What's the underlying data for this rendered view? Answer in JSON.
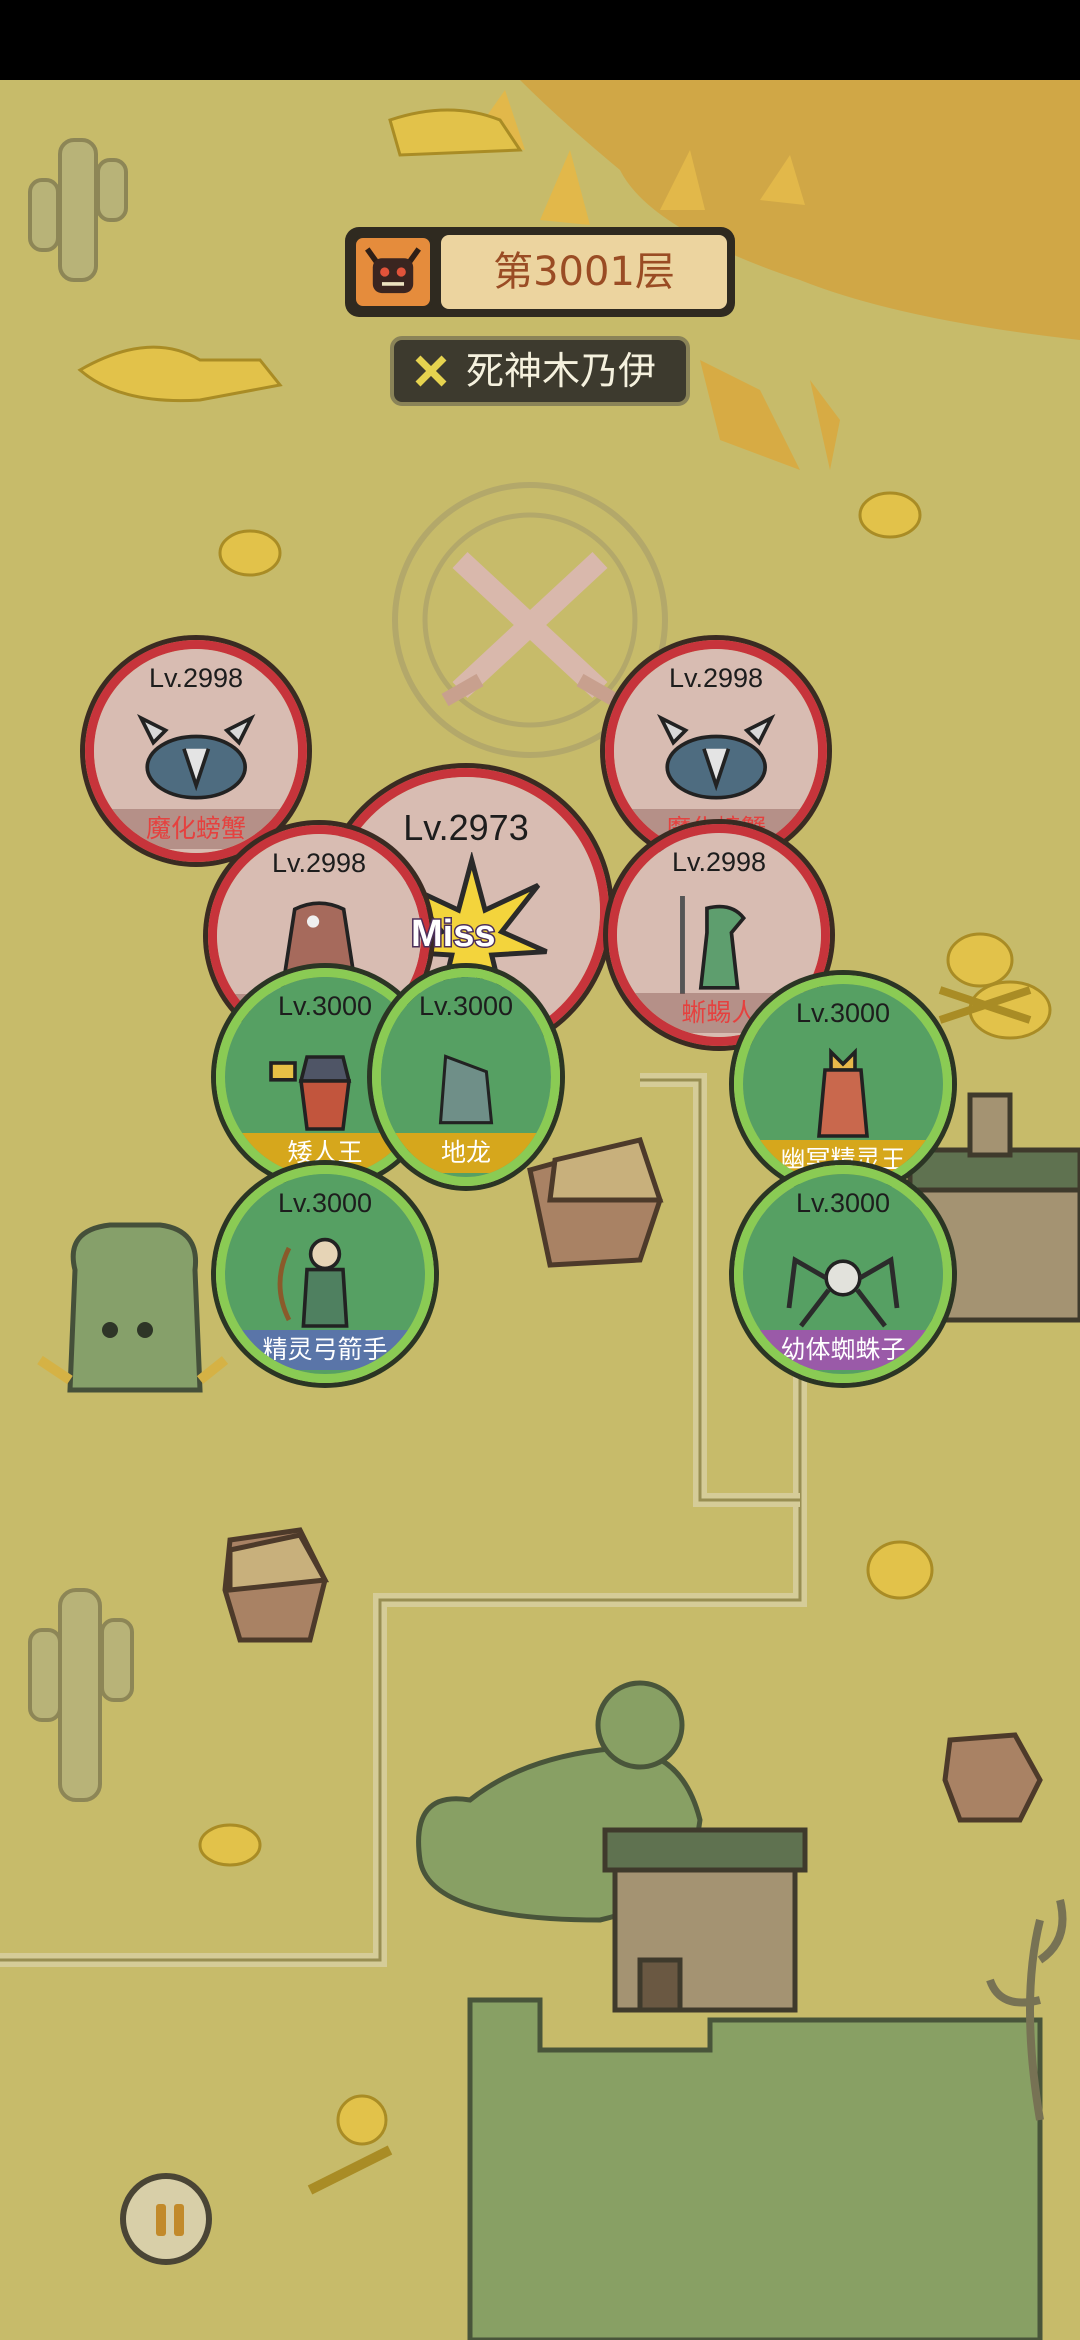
{
  "header": {
    "floor_label": "第3001层",
    "floor_icon": "monster-face-icon",
    "boss_label": "死神木乃伊",
    "boss_icon": "crossed-swords-icon"
  },
  "battle": {
    "miss_text": "Miss",
    "main_enemy": {
      "level": "Lv.2973",
      "name": ""
    },
    "enemies": [
      {
        "level": "Lv.2998",
        "name": "魔化螃蟹"
      },
      {
        "level": "Lv.2998",
        "name": "魔化螃蟹"
      },
      {
        "level": "Lv.2998",
        "name": ""
      },
      {
        "level": "Lv.2998",
        "name": "蜥蜴人"
      }
    ],
    "allies": [
      {
        "level": "Lv.3000",
        "name": "矮人王"
      },
      {
        "level": "Lv.3000",
        "name": "地龙"
      },
      {
        "level": "Lv.3000",
        "name": "幽冥精灵王"
      },
      {
        "level": "Lv.3000",
        "name": "精灵弓箭手"
      },
      {
        "level": "Lv.3000",
        "name": "幼体蜘蛛子"
      }
    ]
  },
  "controls": {
    "pause_icon": "pause-icon"
  },
  "colors": {
    "enemy_ring": "#c7343b",
    "ally_ring": "#8acb54",
    "ally_nameplate": "#d6a71c",
    "map_background": "#c7bb6a"
  }
}
